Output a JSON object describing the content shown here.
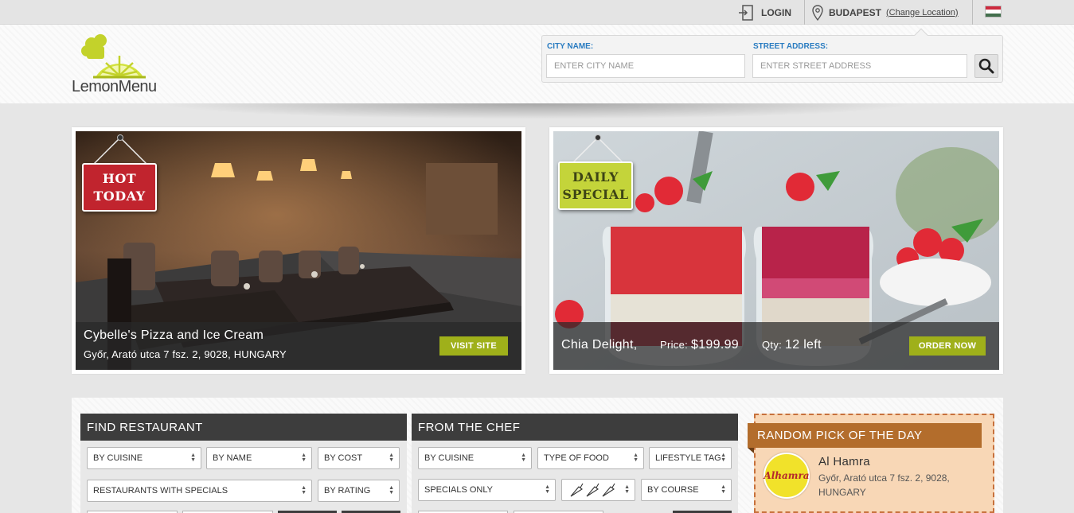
{
  "topbar": {
    "login_label": "LOGIN",
    "city_label": "BUDAPEST",
    "change_location": "(Change Location)",
    "flag_colors": [
      "#cd2a3e",
      "#ffffff",
      "#436f4d"
    ]
  },
  "brand": {
    "name": "LemonMenu",
    "colors": {
      "lemon": "#d2e23c",
      "lemon_dark": "#a9b91d"
    }
  },
  "search": {
    "city_label": "CITY NAME:",
    "city_placeholder": "ENTER CITY NAME",
    "street_label": "STREET ADDRESS:",
    "street_placeholder": "ENTER STREET ADDRESS",
    "button_icon": "magnifier-icon"
  },
  "hot_today": {
    "tag": "HOT\nTODAY",
    "tag_line1": "HOT",
    "tag_line2": "TODAY",
    "name": "Cybelle's Pizza and Ice Cream",
    "address": "Győr, Arató utca 7 fsz. 2, 9028, HUNGARY",
    "button": "VISIT SITE"
  },
  "daily_special": {
    "tag_line1": "DAILY",
    "tag_line2": "SPECIAL",
    "dish": "Chia Delight,",
    "price_label": "Price:",
    "price": "$199.99",
    "qty_label": "Qty:",
    "qty": "12 left",
    "button": "ORDER NOW"
  },
  "find_restaurant": {
    "title": "FIND RESTAURANT",
    "selects": [
      "BY CUISINE",
      "BY NAME",
      "BY COST",
      "RESTAURANTS WITH SPECIALS",
      "BY RATING"
    ]
  },
  "from_chef": {
    "title": "FROM THE CHEF",
    "selects": [
      "BY CUISINE",
      "TYPE OF FOOD",
      "LIFESTYLE TAG",
      "SPECIALS ONLY",
      "BY COURSE"
    ],
    "spice_icon": "chili-pepper-icon"
  },
  "random_pick": {
    "title": "RANDOM PICK OF THE DAY",
    "logo_text": "Alhamra",
    "name": "Al Hamra",
    "address": "Győr, Arató utca 7 fsz. 2, 9028, HUNGARY"
  }
}
